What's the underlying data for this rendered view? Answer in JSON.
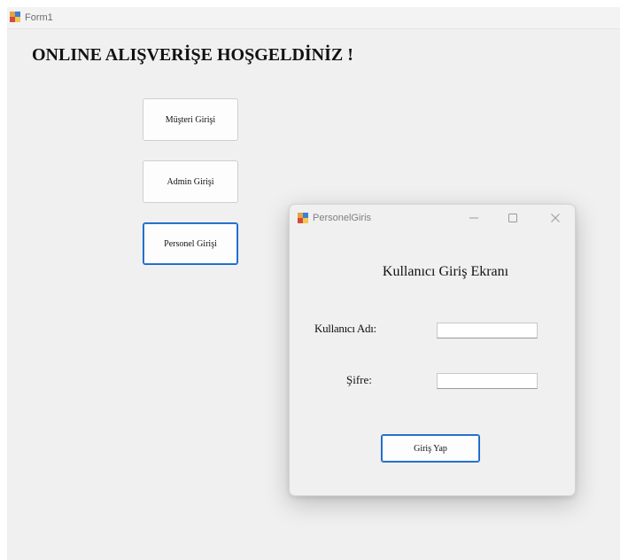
{
  "main_window": {
    "title": "Form1",
    "icon": "winforms-app-icon",
    "heading": "ONLINE ALIŞVERİŞE HOŞGELDİNİZ !",
    "buttons": {
      "customer_login": "Müşteri Girişi",
      "admin_login": "Admin Girişi",
      "staff_login": "Personel Girişi"
    }
  },
  "dialog": {
    "title": "PersonelGiris",
    "icon": "winforms-app-icon",
    "heading": "Kullanıcı Giriş Ekranı",
    "username_label": "Kullanıcı Adı:",
    "username_value": "",
    "password_label": "Şifre:",
    "password_value": "",
    "login_button": "Giriş Yap",
    "caption_buttons": [
      "minimize-icon",
      "maximize-icon",
      "close-icon"
    ]
  },
  "colors": {
    "window_bg": "#f0f0f0",
    "focus_border": "#1a66c4"
  }
}
